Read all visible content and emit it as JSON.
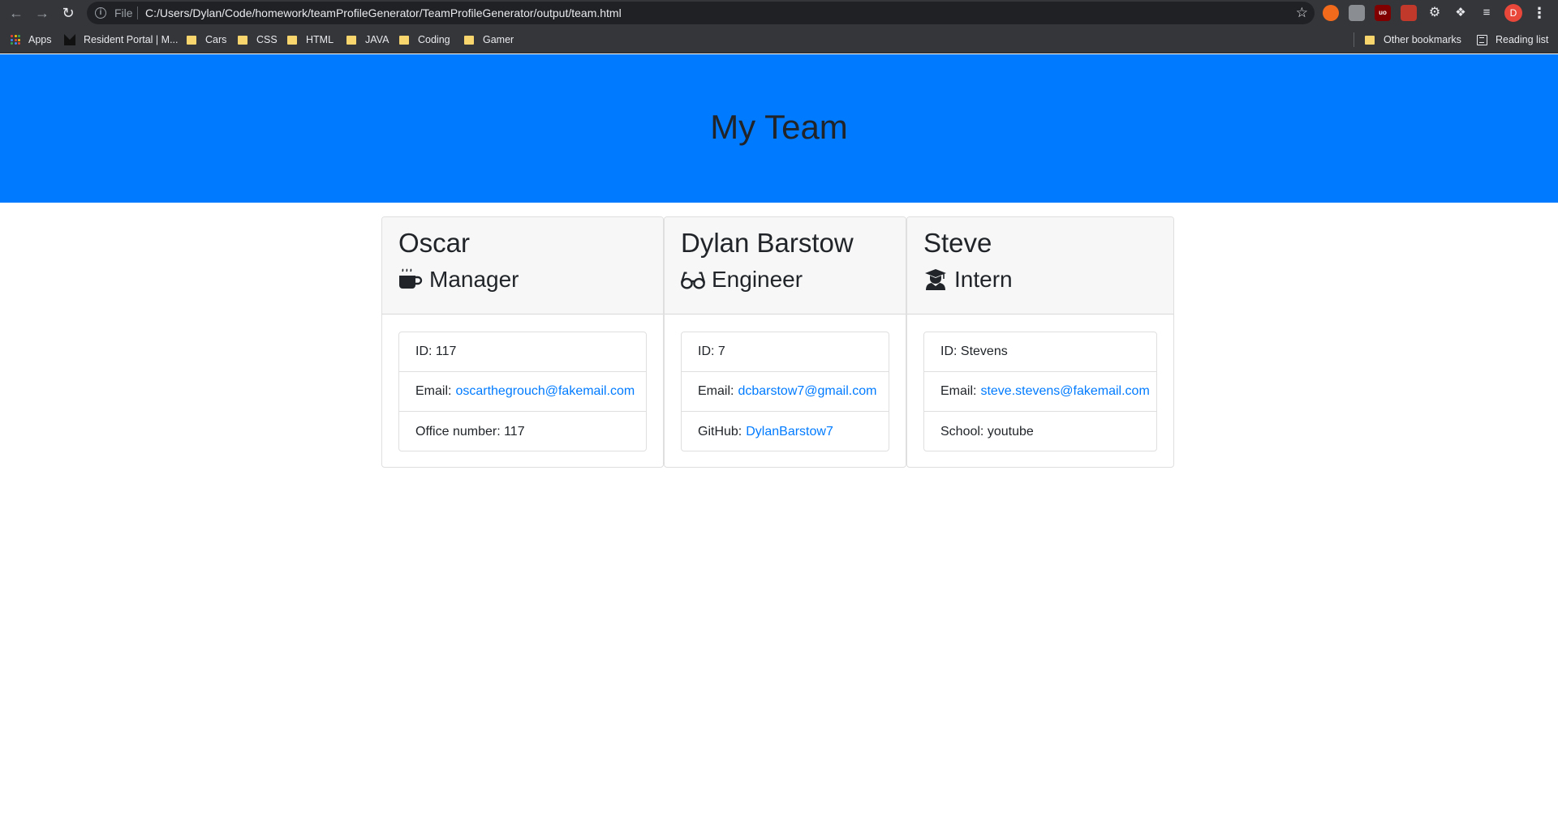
{
  "browser": {
    "url_scheme_label": "File",
    "url": "C:/Users/Dylan/Code/homework/teamProfileGenerator/TeamProfileGenerator/output/team.html",
    "avatar_letter": "D",
    "icons": [
      "back-arrow-icon",
      "forward-arrow-icon",
      "reload-icon",
      "info-icon",
      "star-icon",
      "extensions-puzzle-icon",
      "menu-dots-icon"
    ]
  },
  "bookmarks": {
    "apps": "Apps",
    "items": [
      "Resident Portal | M...",
      "Cars",
      "CSS",
      "HTML",
      "JAVA",
      "Coding",
      "Gamer"
    ],
    "other": "Other bookmarks",
    "reading_list": "Reading list"
  },
  "page": {
    "title": "My Team",
    "colors": {
      "jumbotron": "#007bff",
      "link": "#007bff",
      "card_header": "#f7f7f7"
    }
  },
  "team": [
    {
      "name": "Oscar",
      "role": "Manager",
      "icon": "mug-icon",
      "id_label": "ID:",
      "id": "117",
      "email_label": "Email:",
      "email": "oscarthegrouch@fakemail.com",
      "extra_label": "Office number:",
      "extra": "117"
    },
    {
      "name": "Dylan Barstow",
      "role": "Engineer",
      "icon": "glasses-icon",
      "id_label": "ID:",
      "id": "7",
      "email_label": "Email:",
      "email": "dcbarstow7@gmail.com",
      "extra_label": "GitHub:",
      "extra": "DylanBarstow7"
    },
    {
      "name": "Steve",
      "role": "Intern",
      "icon": "graduate-icon",
      "id_label": "ID:",
      "id": "Stevens",
      "email_label": "Email:",
      "email": "steve.stevens@fakemail.com",
      "extra_label": "School:",
      "extra": "youtube"
    }
  ]
}
